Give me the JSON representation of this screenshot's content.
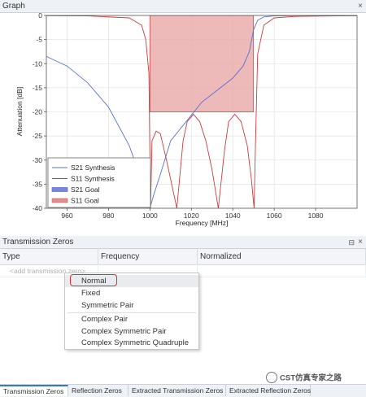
{
  "graph_panel": {
    "title": "Graph",
    "close_glyph": "×"
  },
  "chart_data": {
    "type": "line",
    "xlabel": "Frequency [MHz]",
    "ylabel": "Attenuation [dB]",
    "xlim": [
      950,
      1100
    ],
    "ylim": [
      -40,
      0
    ],
    "x_ticks": [
      960,
      980,
      1000,
      1020,
      1040,
      1060,
      1080
    ],
    "y_ticks": [
      0,
      -5,
      -10,
      -15,
      -20,
      -25,
      -30,
      -35,
      -40
    ],
    "grid": true,
    "legend_position": "bottom-left",
    "series": [
      {
        "name": "S21 Synthesis",
        "color": "#5b6fd6",
        "x": [
          950,
          960,
          970,
          980,
          990,
          995,
          998,
          1000,
          1002,
          1005,
          1010,
          1025,
          1040,
          1045,
          1048,
          1050,
          1052,
          1055,
          1060,
          1070,
          1080,
          1090,
          1100
        ],
        "y": [
          -8.5,
          -10.5,
          -14,
          -19,
          -27,
          -33,
          -37.5,
          -40,
          -37,
          -33,
          -26,
          -18,
          -13,
          -10.5,
          -7.5,
          -3,
          -1,
          -0.3,
          -0.1,
          -0.05,
          -0.05,
          -0.05,
          -0.05
        ]
      },
      {
        "name": "S11 Synthesis",
        "color": "#cf3c3c",
        "x": [
          950,
          970,
          990,
          996,
          998,
          999.5,
          1000.3,
          1001,
          1003,
          1005,
          1008,
          1010,
          1013,
          1016,
          1018,
          1021,
          1024,
          1027,
          1030,
          1033,
          1036,
          1038,
          1041,
          1044,
          1047,
          1049,
          1050.3,
          1051,
          1052,
          1055,
          1060,
          1070,
          1100
        ],
        "y": [
          -0.05,
          -0.1,
          -0.5,
          -2,
          -5,
          -12,
          -40,
          -26,
          -24,
          -24.5,
          -30,
          -34,
          -40,
          -26,
          -22,
          -20.5,
          -22,
          -26,
          -32,
          -40,
          -28,
          -22,
          -20.5,
          -22,
          -27,
          -34,
          -40,
          -26,
          -8,
          -2,
          -0.5,
          -0.2,
          -0.05
        ]
      }
    ],
    "legend_entries": [
      {
        "name": "S21 Synthesis",
        "color": "#5b6fd6"
      },
      {
        "name": "S11 Synthesis",
        "color": "#cf3c3c"
      },
      {
        "name": "S21 Goal",
        "color": "#4b5fd0"
      },
      {
        "name": "S11 Goal",
        "color": "#d06b6b"
      }
    ],
    "goal_region": {
      "x": [
        1000,
        1050
      ],
      "y": [
        -20,
        0
      ],
      "fill": "#e9a8a8",
      "stroke": "#cc5555"
    }
  },
  "tz_panel": {
    "title": "Transmission Zeros",
    "pin_glyph": "⊟",
    "close_glyph": "×"
  },
  "table": {
    "columns": [
      "Type",
      "Frequency",
      "Normalized"
    ],
    "add_placeholder": "<add transmission zero>"
  },
  "menu": {
    "items": [
      "Normal",
      "Fixed",
      "Symmetric Pair",
      "Complex Pair",
      "Complex Symmetric Pair",
      "Complex Symmetric Quadruple"
    ]
  },
  "tabs": [
    "Transmission Zeros",
    "Reflection Zeros",
    "Extracted Transmission Zeros",
    "Extracted Reflection Zeros"
  ],
  "watermark": {
    "text": "CST仿真专家之路"
  }
}
